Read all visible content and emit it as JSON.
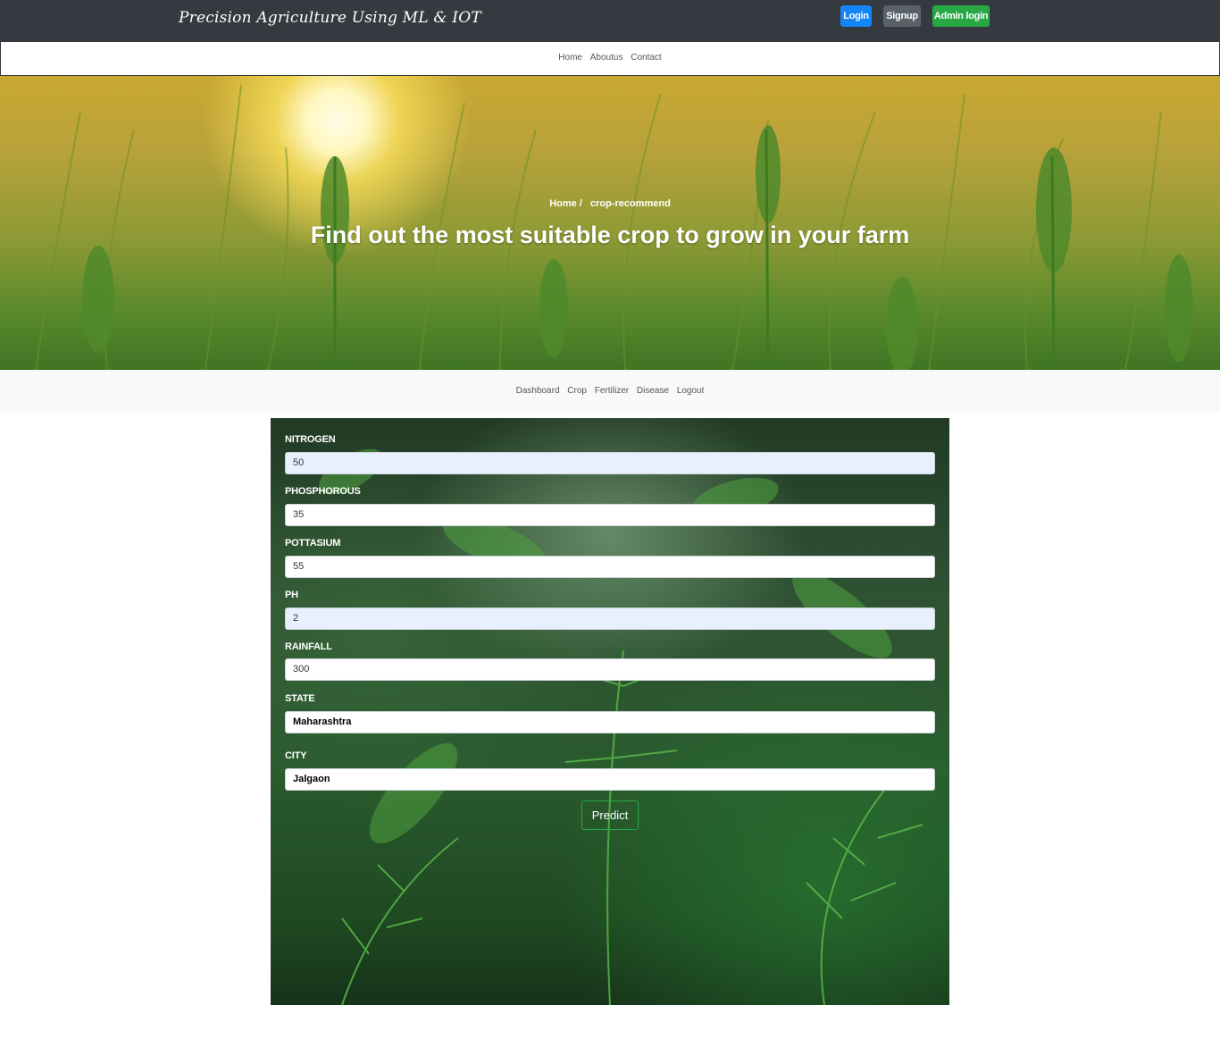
{
  "header": {
    "brand": "Precision Agriculture Using ML & IOT",
    "login_label": "Login",
    "signup_label": "Signup",
    "admin_login_label": "Admin login"
  },
  "main_nav": {
    "items": [
      "Home",
      "Aboutus",
      "Contact"
    ]
  },
  "hero": {
    "breadcrumb_home": "Home /",
    "breadcrumb_current": "crop-recommend",
    "title": "Find out the most suitable crop to grow in your farm"
  },
  "sub_nav": {
    "items": [
      "Dashboard",
      "Crop",
      "Fertilizer",
      "Disease",
      "Logout"
    ]
  },
  "form": {
    "fields": [
      {
        "label": "NITROGEN",
        "value": "50"
      },
      {
        "label": "PHOSPHOROUS",
        "value": "35"
      },
      {
        "label": "POTTASIUM",
        "value": "55"
      },
      {
        "label": "PH",
        "value": "2"
      },
      {
        "label": "RAINFALL",
        "value": "300"
      },
      {
        "label": "STATE",
        "value": "Maharashtra"
      },
      {
        "label": "CITY",
        "value": "Jalgaon"
      }
    ],
    "submit_label": "Predict"
  },
  "colors": {
    "header_bg": "#343a40",
    "login": "#1385f7",
    "signup": "#5a6269",
    "admin_login": "#28a745",
    "predict_border": "#28a745",
    "autofill_bg": "#e8f0fe"
  }
}
